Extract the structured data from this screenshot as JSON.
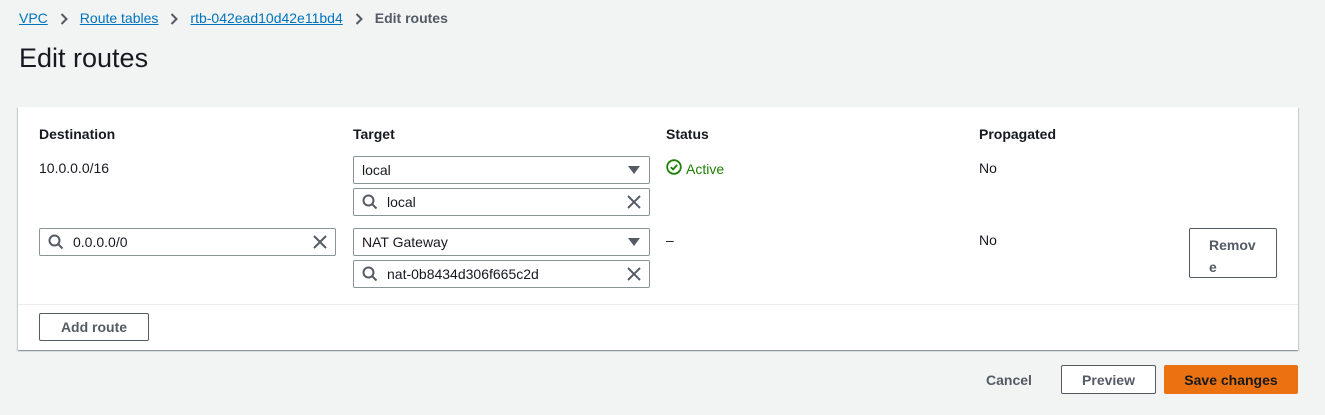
{
  "breadcrumb": {
    "items": [
      "VPC",
      "Route tables",
      "rtb-042ead10d42e11bd4"
    ],
    "current": "Edit routes"
  },
  "page": {
    "title": "Edit routes"
  },
  "table": {
    "headers": {
      "destination": "Destination",
      "target": "Target",
      "status": "Status",
      "propagated": "Propagated"
    },
    "rows": [
      {
        "destination": "10.0.0.0/16",
        "target_type": "local",
        "target_value": "local",
        "status": "Active",
        "propagated": "No"
      },
      {
        "destination": "0.0.0.0/0",
        "target_type": "NAT Gateway",
        "target_value": "nat-0b8434d306f665c2d",
        "status": "–",
        "propagated": "No",
        "remove_label": "Remove"
      }
    ]
  },
  "actions": {
    "add_route": "Add route",
    "cancel": "Cancel",
    "preview": "Preview",
    "save": "Save changes"
  },
  "colors": {
    "link": "#0073bb",
    "active_status": "#1d8102",
    "primary_button": "#ec7211",
    "background": "#f2f3f3"
  },
  "icons": {
    "breadcrumb_separator": "chevron-right-icon",
    "dropdown": "caret-down-icon",
    "search": "search-icon",
    "clear": "close-icon",
    "status": "check-circle-icon"
  }
}
